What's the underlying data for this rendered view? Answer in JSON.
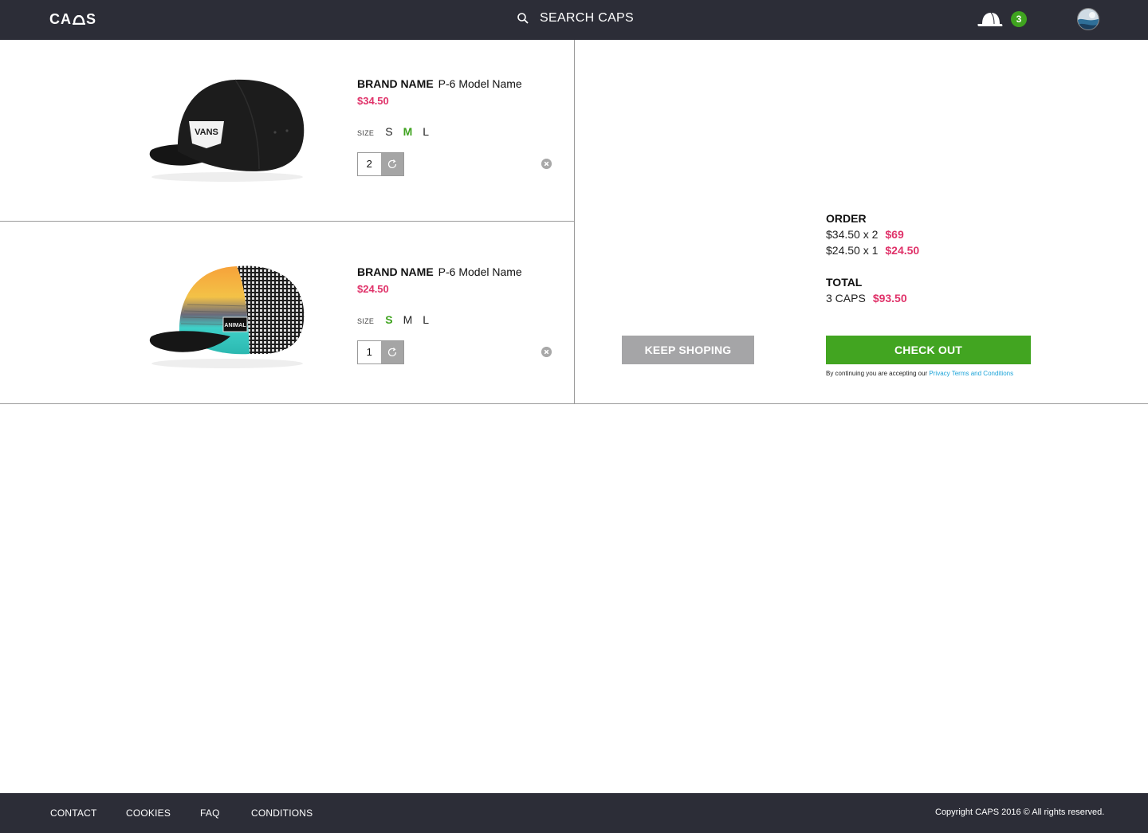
{
  "header": {
    "logo": "CAPS",
    "search_placeholder": "SEARCH CAPS",
    "cart_count": "3",
    "icons": {
      "search": "search-icon",
      "cart": "cap-icon",
      "avatar": "avatar"
    }
  },
  "cart": {
    "items": [
      {
        "brand": "BRAND NAME",
        "model": "P-6 Model Name",
        "price": "$34.50",
        "size_label": "SIZE",
        "sizes": [
          "S",
          "M",
          "L"
        ],
        "selected_size": "M",
        "quantity": "2",
        "image": "black-vans-snapback-cap"
      },
      {
        "brand": "BRAND NAME",
        "model": "P-6 Model Name",
        "price": "$24.50",
        "size_label": "SIZE",
        "sizes": [
          "S",
          "M",
          "L"
        ],
        "selected_size": "S",
        "quantity": "1",
        "image": "striped-trucker-cap"
      }
    ]
  },
  "order": {
    "heading": "ORDER",
    "lines": [
      {
        "desc": "$34.50 x 2",
        "amount": "$69"
      },
      {
        "desc": "$24.50 x 1",
        "amount": "$24.50"
      }
    ],
    "total_heading": "TOTAL",
    "total_desc": "3 CAPS",
    "total_amount": "$93.50",
    "keep_label": "KEEP SHOPING",
    "checkout_label": "CHECK OUT",
    "legal_text": "By continuing you are accepting our ",
    "legal_link": "Privacy Terms and Conditions"
  },
  "footer": {
    "links": [
      "CONTACT",
      "COOKIES",
      "FAQ",
      "CONDITIONS"
    ],
    "copyright": "Copyright CAPS 2016 ©  All rights reserved."
  },
  "colors": {
    "header_bg": "#2c2d37",
    "price": "#e0336a",
    "accent_green": "#42a521",
    "button_grey": "#a5a5a7",
    "link_blue": "#1aa3d8"
  }
}
